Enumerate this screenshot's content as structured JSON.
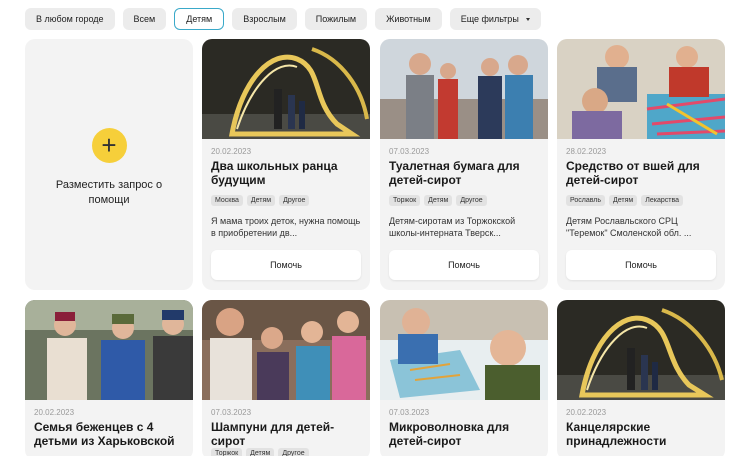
{
  "filters": [
    {
      "label": "В любом городе",
      "active": false
    },
    {
      "label": "Всем",
      "active": false
    },
    {
      "label": "Детям",
      "active": true
    },
    {
      "label": "Взрослым",
      "active": false
    },
    {
      "label": "Пожилым",
      "active": false
    },
    {
      "label": "Животным",
      "active": false
    },
    {
      "label": "Еще фильтры",
      "active": false,
      "dropdown": true
    }
  ],
  "add_request": {
    "icon": "plus-icon",
    "label": "Разместить запрос о помощи"
  },
  "help_label": "Помочь",
  "cards": [
    {
      "date": "20.02.2023",
      "title": "Два школьных ранца будущим",
      "tags": [
        "Москва",
        "Детям",
        "Другое"
      ],
      "description": "Я мама троих деток, нужна помощь в приобретении дв..."
    },
    {
      "date": "07.03.2023",
      "title": "Туалетная бумага для детей-сирот",
      "tags": [
        "Торжок",
        "Детям",
        "Другое"
      ],
      "description": "Детям-сиротам из Торжокской школы-интерната Тверск..."
    },
    {
      "date": "28.02.2023",
      "title": "Средство от вшей для детей-сирот",
      "tags": [
        "Рославль",
        "Детям",
        "Лекарства"
      ],
      "description": "Детям Рославльского СРЦ \"Теремок\" Смоленской обл. ..."
    },
    {
      "date": "20.02.2023",
      "title": "Семья беженцев с 4 детьми из Харьковской",
      "tags": [],
      "description": ""
    },
    {
      "date": "07.03.2023",
      "title": "Шампуни для детей-сирот",
      "tags": [
        "Торжок",
        "Детям",
        "Другое"
      ],
      "description": ""
    },
    {
      "date": "07.03.2023",
      "title": "Микроволновка для детей-сирот",
      "tags": [],
      "description": ""
    },
    {
      "date": "20.02.2023",
      "title": "Канцелярские принадлежности",
      "tags": [],
      "description": ""
    }
  ]
}
